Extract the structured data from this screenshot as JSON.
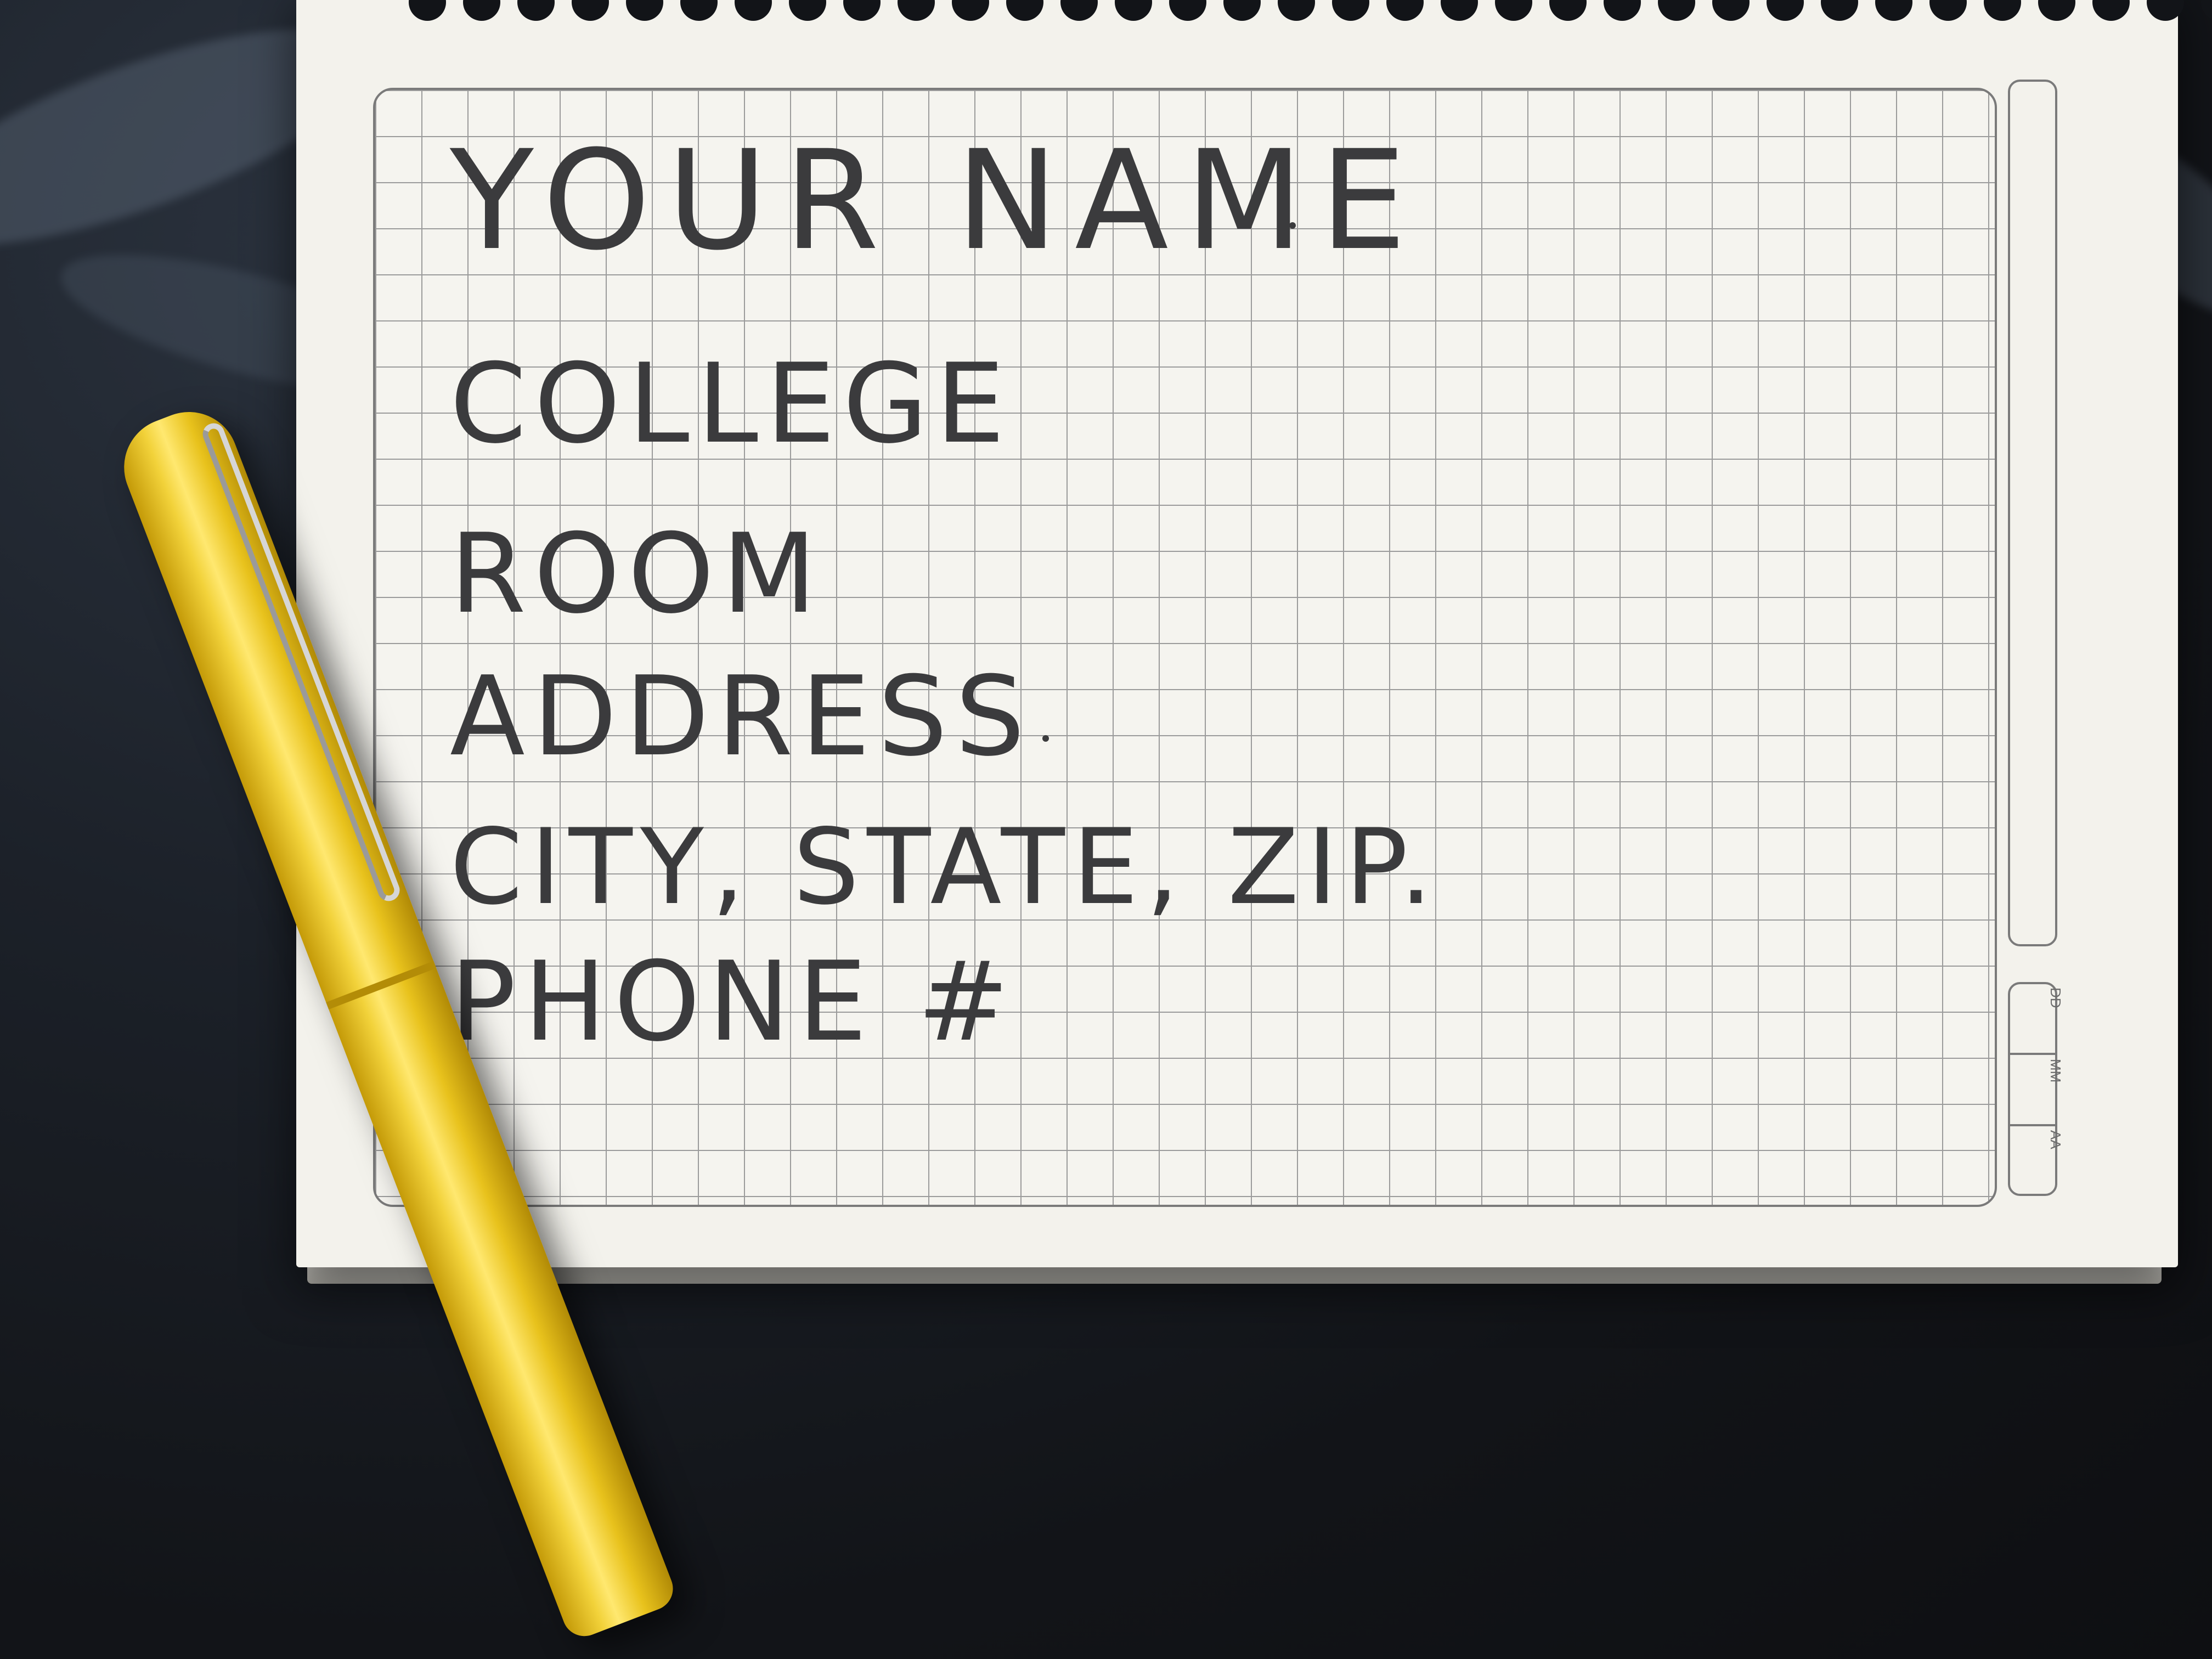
{
  "notebook": {
    "lines": [
      "YOUR NAME",
      "COLLEGE",
      "ROOM",
      "ADDRESS",
      "CITY, STATE, ZIP.",
      "PHONE #"
    ],
    "date_labels": [
      "DD",
      "MM",
      "AA"
    ],
    "colors": {
      "paper": "#f3f2ec",
      "grid": "#9b9b9b",
      "ink": "#3b3b3d",
      "pen": "#f2d23a",
      "background": "#15181d"
    }
  },
  "objects": {
    "pen_icon": "yellow-fountain-pen-icon",
    "notebook_icon": "spiral-grid-notebook-icon"
  }
}
